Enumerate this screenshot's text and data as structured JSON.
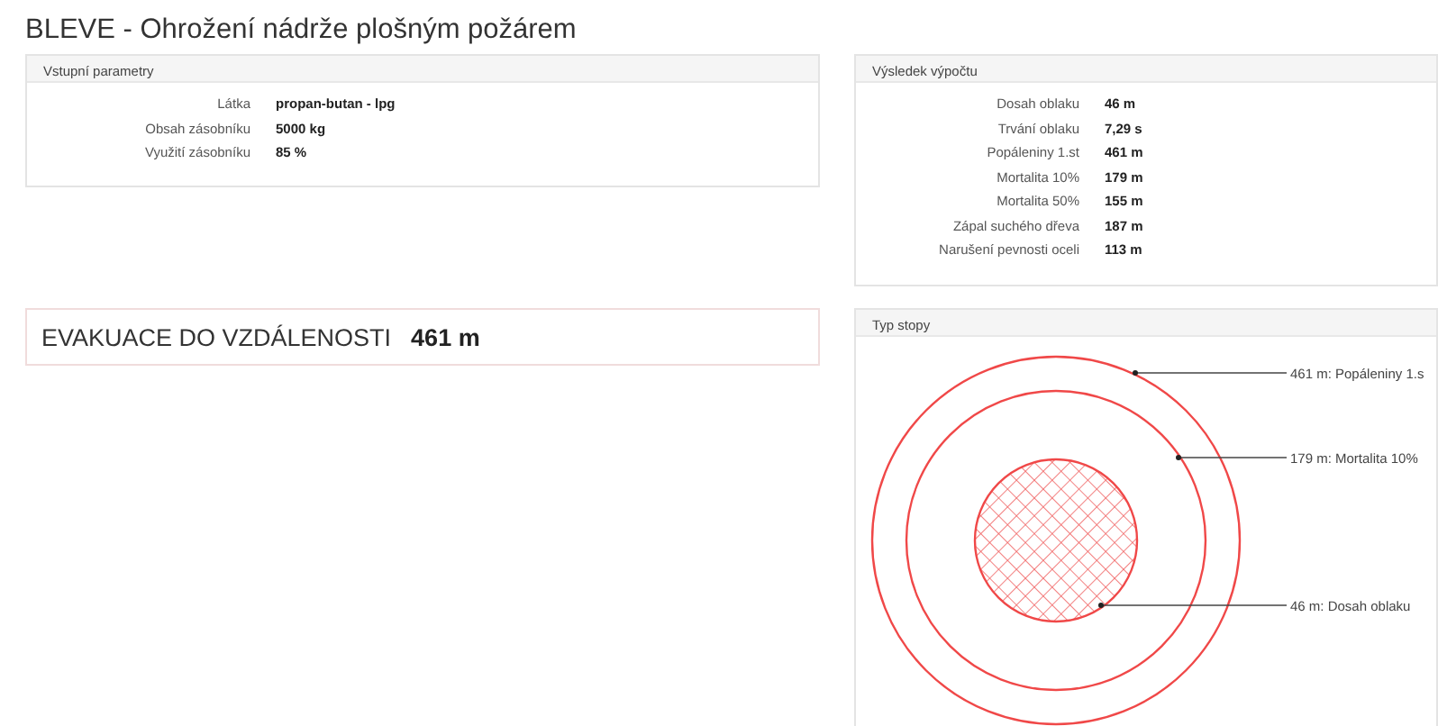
{
  "title": "BLEVE - Ohrožení nádrže plošným požárem",
  "inputs": {
    "heading": "Vstupní parametry",
    "rows": [
      {
        "label": "Látka",
        "value": "propan-butan - lpg"
      },
      {
        "label": "Obsah zásobníku",
        "value": "5000 kg"
      },
      {
        "label": "Využití zásobníku",
        "value": "85 %"
      }
    ]
  },
  "evacuation": {
    "label": "EVAKUACE DO VZDÁLENOSTI",
    "value": "461 m"
  },
  "results": {
    "heading": "Výsledek výpočtu",
    "rows": [
      {
        "label": "Dosah oblaku",
        "value": "46 m"
      },
      {
        "label": "Trvání oblaku",
        "value": "7,29 s"
      },
      {
        "label": "Popáleniny 1.st",
        "value": "461 m"
      },
      {
        "label": "Mortalita 10%",
        "value": "179 m"
      },
      {
        "label": "Mortalita 50%",
        "value": "155 m"
      },
      {
        "label": "Zápal suchého dřeva",
        "value": "187 m"
      },
      {
        "label": "Narušení pevnosti oceli",
        "value": "113 m"
      }
    ]
  },
  "footprint": {
    "heading": "Typ stopy",
    "zones": [
      {
        "kind": "ring",
        "label": "461 m: Popáleniny 1.s"
      },
      {
        "kind": "ring",
        "label": "179 m: Mortalita 10%"
      },
      {
        "kind": "hatched",
        "label": "46 m: Dosah oblaku"
      }
    ]
  }
}
